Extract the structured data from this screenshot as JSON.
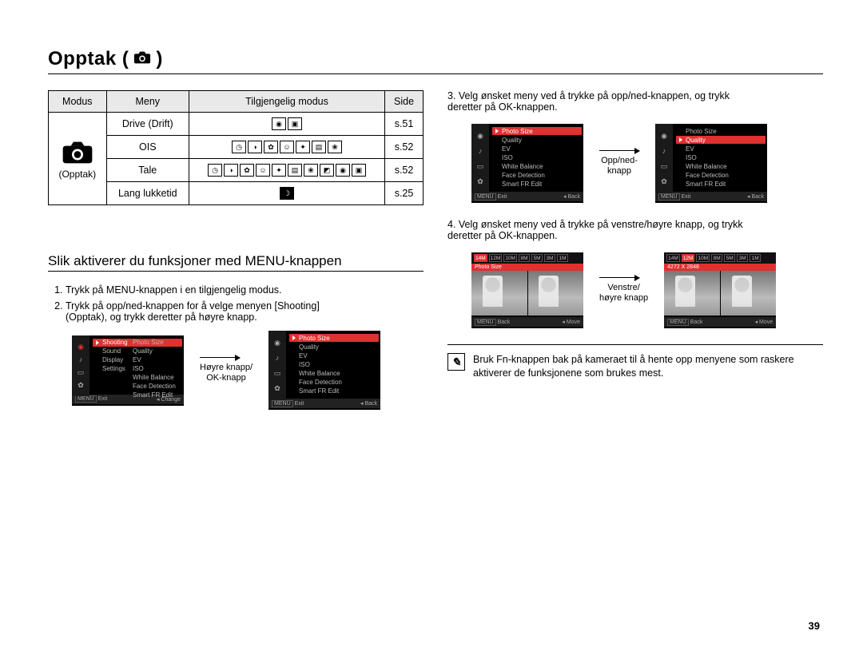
{
  "title_text": "Opptak (",
  "title_close": ")",
  "table": {
    "headers": {
      "modus": "Modus",
      "meny": "Meny",
      "tilgjengelig": "Tilgjengelig modus",
      "side": "Side"
    },
    "mode_label": "(Opptak)",
    "rows": [
      {
        "meny": "Drive (Drift)",
        "side": "s.51"
      },
      {
        "meny": "OIS",
        "side": "s.52"
      },
      {
        "meny": "Tale",
        "side": "s.52"
      },
      {
        "meny": "Lang lukketid",
        "side": "s.25"
      }
    ]
  },
  "section_heading": "Slik aktiverer du funksjoner med MENU-knappen",
  "steps_left": {
    "s1": "Trykk på MENU-knappen i en tilgjengelig modus.",
    "s2a": "Trykk på opp/ned-knappen for å velge menyen [Shooting]",
    "s2b": "(Opptak), og trykk deretter på høyre knapp."
  },
  "steps_right": {
    "s3a": "Velg ønsket meny ved å trykke på opp/ned-knappen, og trykk",
    "s3b": "deretter på OK-knappen.",
    "s4a": "Velg ønsket meny ved å trykke på venstre/høyre knapp, og trykk",
    "s4b": "deretter på OK-knappen."
  },
  "arrow_labels": {
    "hoyre": "Høyre knapp/\nOK-knapp",
    "oppned": "Opp/ned-\nknapp",
    "venstre": "Venstre/\nhøyre knapp"
  },
  "lcd": {
    "left_panel": {
      "items": [
        "Shooting",
        "Sound",
        "Display",
        "Settings"
      ],
      "exit": "Exit",
      "change": "Change"
    },
    "menu": {
      "items": [
        "Photo Size",
        "Quality",
        "EV",
        "ISO",
        "White Balance",
        "Face Detection",
        "Smart FR Edit"
      ],
      "exit": "Exit",
      "back": "Back"
    },
    "menu_sel_quality": "Quality",
    "photosize": {
      "chips": [
        "14M",
        "12M",
        "10M",
        "8M",
        "5M",
        "3M",
        "1M"
      ],
      "label": "Photo Size",
      "dim": "4272 X 2848",
      "back": "Back",
      "move": "Move"
    }
  },
  "note_text": "Bruk Fn-knappen bak på kameraet til å hente opp menyene som raskere aktiverer de funksjonene som brukes mest.",
  "page_number": "39"
}
